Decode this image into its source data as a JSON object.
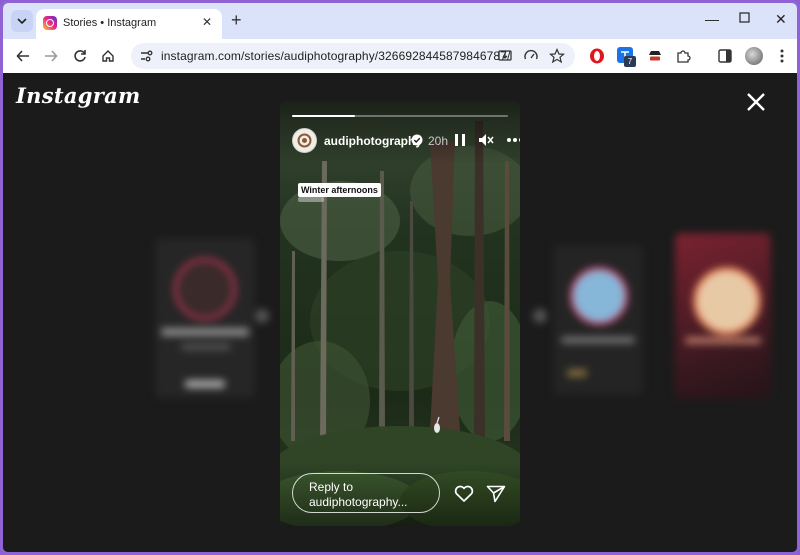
{
  "browser": {
    "tab_title": "Stories • Instagram",
    "url": "instagram.com/stories/audiphotography/3266928445879846787/",
    "extension_badge": "7"
  },
  "page": {
    "logo_text": "Instagram"
  },
  "story": {
    "username": "audiphotography",
    "time_ago": "20h",
    "sticker_text": "Winter afternoons",
    "reply_placeholder": "Reply to audiphotography...",
    "progress_fraction": 0.29
  },
  "colors": {
    "accent_purple": "#8f63d6",
    "tab_strip": "#dbe3fb",
    "page_bg": "#1b1b1b"
  }
}
